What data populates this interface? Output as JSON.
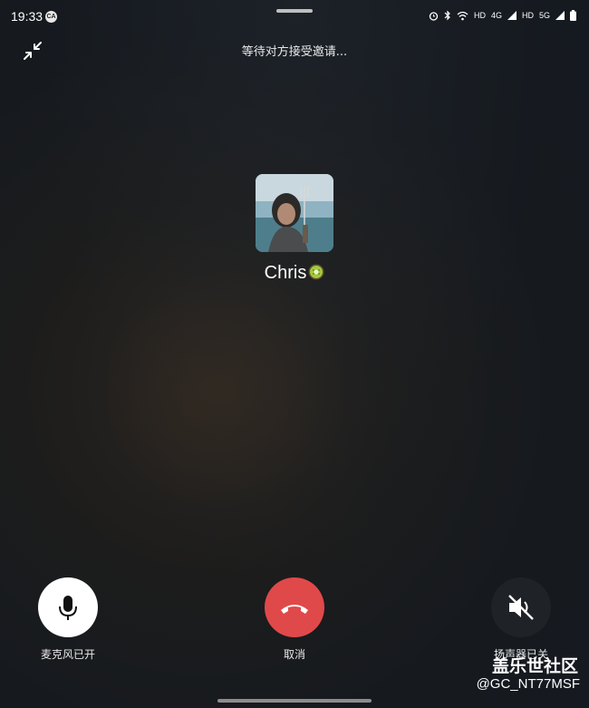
{
  "status_bar": {
    "time": "19:33",
    "badge": "CA",
    "indicators": [
      "alarm-icon",
      "bluetooth-icon",
      "wifi-icon",
      "HD",
      "4G",
      "HD",
      "5G",
      "battery-icon"
    ]
  },
  "call": {
    "status_text": "等待对方接受邀请...",
    "contact_name": "Chris",
    "name_emoji": "kiwi-icon"
  },
  "controls": {
    "mic_label": "麦克风已开",
    "end_label": "取消",
    "speaker_label": "扬声器已关"
  },
  "watermark": {
    "line1": "盖乐世社区",
    "line2": "@GC_NT77MSF"
  },
  "colors": {
    "end_call_red": "#e0494a",
    "mic_button": "#ffffff",
    "speaker_button": "#1f2226"
  }
}
